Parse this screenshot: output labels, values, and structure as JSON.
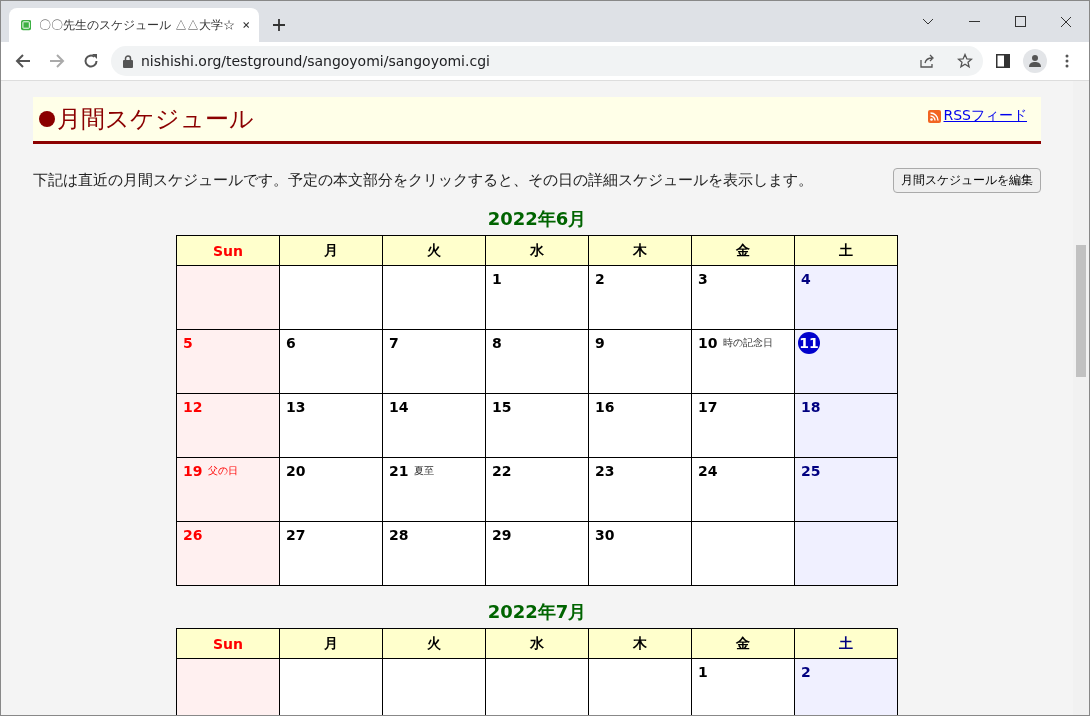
{
  "browser": {
    "tab": {
      "title": "〇〇先生のスケジュール △△大学☆",
      "selected": true
    },
    "address": "nishishi.org/testground/sangoyomi/sangoyomi.cgi"
  },
  "page": {
    "heading": "月間スケジュール",
    "rss_link": "RSSフィード",
    "description": "下記は直近の月間スケジュールです。予定の本文部分をクリックすると、その日の詳細スケジュールを表示します。",
    "edit_button": "月間スケジュールを編集"
  },
  "months": [
    {
      "title": "2022年6月",
      "headers": [
        {
          "label": "Sun",
          "kind": "sunday"
        },
        {
          "label": "月",
          "kind": "weekday"
        },
        {
          "label": "火",
          "kind": "weekday"
        },
        {
          "label": "水",
          "kind": "weekday"
        },
        {
          "label": "木",
          "kind": "weekday"
        },
        {
          "label": "金",
          "kind": "weekday"
        },
        {
          "label": "土",
          "kind": "weekday"
        }
      ],
      "weeks": [
        [
          {
            "kind": "blank"
          },
          {
            "kind": "blank"
          },
          {
            "kind": "blank"
          },
          {
            "kind": "day",
            "day": "1",
            "today": false
          },
          {
            "day": "2",
            "today": false
          },
          {
            "day": "3",
            "today": false
          },
          {
            "day": "4",
            "today": false
          }
        ],
        [
          {
            "day": "5",
            "today": false
          },
          {
            "day": "6",
            "today": false
          },
          {
            "day": "7",
            "today": false
          },
          {
            "day": "8",
            "today": false
          },
          {
            "day": "9",
            "today": false
          },
          {
            "day": "10",
            "today": false,
            "note": "時の記念日"
          },
          {
            "day": "11",
            "today": true
          }
        ],
        [
          {
            "day": "12",
            "today": false
          },
          {
            "day": "13",
            "today": false
          },
          {
            "day": "14",
            "today": false
          },
          {
            "day": "15",
            "today": false
          },
          {
            "day": "16",
            "today": false
          },
          {
            "day": "17",
            "today": false
          },
          {
            "day": "18",
            "today": false
          }
        ],
        [
          {
            "day": "19",
            "today": false,
            "note": "父の日"
          },
          {
            "day": "20",
            "today": false
          },
          {
            "day": "21",
            "today": false,
            "note": "夏至"
          },
          {
            "day": "22",
            "today": false
          },
          {
            "day": "23",
            "today": false
          },
          {
            "day": "24",
            "today": false
          },
          {
            "day": "25",
            "today": false
          }
        ],
        [
          {
            "day": "26",
            "today": false
          },
          {
            "day": "27",
            "today": false
          },
          {
            "day": "28",
            "today": false
          },
          {
            "day": "29",
            "today": false
          },
          {
            "day": "30",
            "today": false
          },
          {
            "kind": "blank"
          },
          {
            "kind": "blank"
          }
        ]
      ]
    },
    {
      "title": "2022年7月",
      "headers": [
        {
          "label": "Sun",
          "kind": "sunday"
        },
        {
          "label": "月",
          "kind": "weekday"
        },
        {
          "label": "火",
          "kind": "weekday"
        },
        {
          "label": "水",
          "kind": "weekday"
        },
        {
          "label": "木",
          "kind": "weekday"
        },
        {
          "label": "金",
          "kind": "weekday"
        },
        {
          "label": "土",
          "kind": "saturday"
        }
      ],
      "weeks": [
        [
          {
            "kind": "blank"
          },
          {
            "kind": "blank"
          },
          {
            "kind": "blank"
          },
          {
            "kind": "blank"
          },
          {
            "kind": "blank"
          },
          {
            "kind": "day",
            "day": "1",
            "today": false
          },
          {
            "day": "2",
            "today": false
          }
        ]
      ]
    }
  ]
}
